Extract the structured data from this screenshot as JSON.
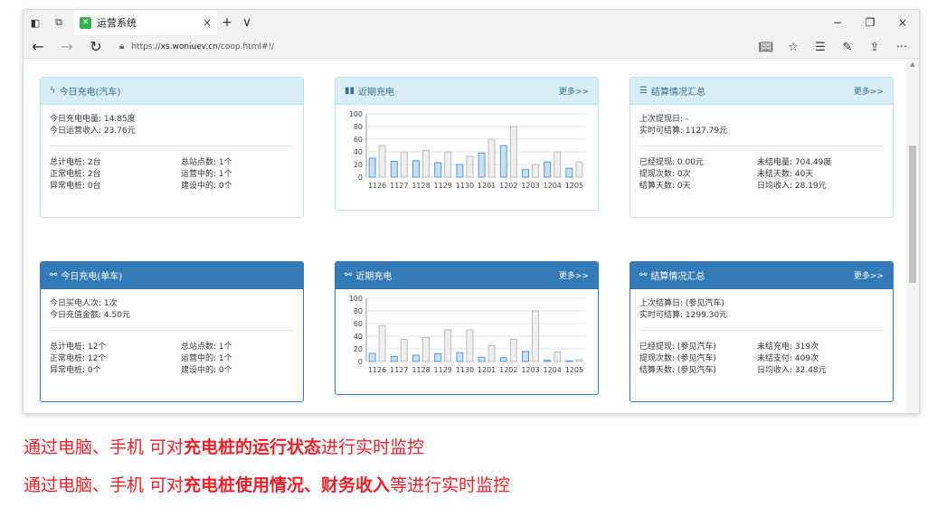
{
  "browser": {
    "tab_title": "运营系统",
    "tab_close": "×",
    "new_tab": "+",
    "tab_menu": "∨",
    "url_prefix": "https://",
    "url_host": "xs.woniuev.cn",
    "url_path": "/coop.html#!/",
    "min": "−",
    "max": "❐",
    "close": "×"
  },
  "panels": {
    "car_today": {
      "title": "今日充电(汽车)",
      "icon": "bolt-icon",
      "lines": [
        "今日充电电量: 14.85度",
        "今日运营收入: 23.76元"
      ],
      "left": [
        "总计电桩: 2台",
        "正常电桩: 2台",
        "异常电桩: 0台"
      ],
      "right": [
        "总站点数: 1个",
        "运营中的: 1个",
        "建设中的: 0个"
      ]
    },
    "car_recent": {
      "title": "近期充电",
      "icon": "bar-chart-icon",
      "more": "更多>>"
    },
    "car_settle": {
      "title": "结算情况汇总",
      "icon": "list-icon",
      "more": "更多>>",
      "lines": [
        "上次提现日: -",
        "实时可结算: 1127.79元"
      ],
      "left": [
        "已经提现: 0.00元",
        "提现次数: 0次",
        "结算天数: 0天"
      ],
      "right": [
        "未结电量: 704.49度",
        "未结天数: 40天",
        "日均收入: 28.19元"
      ]
    },
    "bike_today": {
      "title": "今日充电(单车)",
      "icon": "bicycle-icon",
      "lines": [
        "今日买电人次: 1次",
        "今日充值金额: 4.50元"
      ],
      "left": [
        "总计电桩: 12个",
        "正常电桩: 12个",
        "异常电桩: 0个"
      ],
      "right": [
        "总站点数: 1个",
        "运营中的: 1个",
        "建设中的: 0个"
      ]
    },
    "bike_recent": {
      "title": "近期充电",
      "icon": "bicycle-icon",
      "more": "更多>>"
    },
    "bike_settle": {
      "title": "结算情况汇总",
      "icon": "bicycle-icon",
      "more": "更多>>",
      "lines": [
        "上次结算日: (参见汽车)",
        "实时可结算: 1299.30元"
      ],
      "left": [
        "已经提现: (参见汽车)",
        "提现次数: (参见汽车)",
        "结算天数: (参见汽车)"
      ],
      "right": [
        "未结充电: 319次",
        "未结支付: 409次",
        "日均收入: 32.48元"
      ]
    }
  },
  "chart_data": [
    {
      "type": "bar",
      "categories": [
        "1126",
        "1127",
        "1128",
        "1129",
        "1130",
        "1201",
        "1202",
        "1203",
        "1204",
        "1205"
      ],
      "yticks": [
        "100",
        "80",
        "60",
        "40",
        "20",
        "0"
      ],
      "ylim": [
        0,
        100
      ],
      "series": [
        {
          "values": [
            30,
            25,
            26,
            23,
            20,
            38,
            50,
            12,
            24,
            14
          ]
        },
        {
          "values": [
            50,
            40,
            42,
            40,
            33,
            60,
            80,
            20,
            40,
            24
          ]
        }
      ],
      "colors": [
        "#c6dff2",
        "#eeeeee"
      ],
      "strokes": [
        "#5b9bd5",
        "#bbbbbb"
      ]
    },
    {
      "type": "bar",
      "categories": [
        "1126",
        "1127",
        "1128",
        "1129",
        "1130",
        "1201",
        "1202",
        "1203",
        "1204",
        "1205"
      ],
      "yticks": [
        "100",
        "80",
        "60",
        "40",
        "20",
        "0"
      ],
      "ylim": [
        0,
        100
      ],
      "series": [
        {
          "values": [
            13,
            8,
            10,
            12,
            14,
            7,
            6,
            16,
            2,
            1
          ]
        },
        {
          "values": [
            57,
            35,
            38,
            50,
            50,
            25,
            35,
            80,
            15,
            3
          ]
        }
      ],
      "colors": [
        "#c6dff2",
        "#eeeeee"
      ],
      "strokes": [
        "#5b9bd5",
        "#bbbbbb"
      ]
    }
  ],
  "captions": {
    "line1_a": "通过电脑、手机 可对",
    "line1_b": "充电桩的运行状态",
    "line1_c": "进行实时监控",
    "line2_a": "通过电脑、手机 可对",
    "line2_b": "充电桩使用情况、财务收入",
    "line2_c": "等进行实时监控"
  }
}
